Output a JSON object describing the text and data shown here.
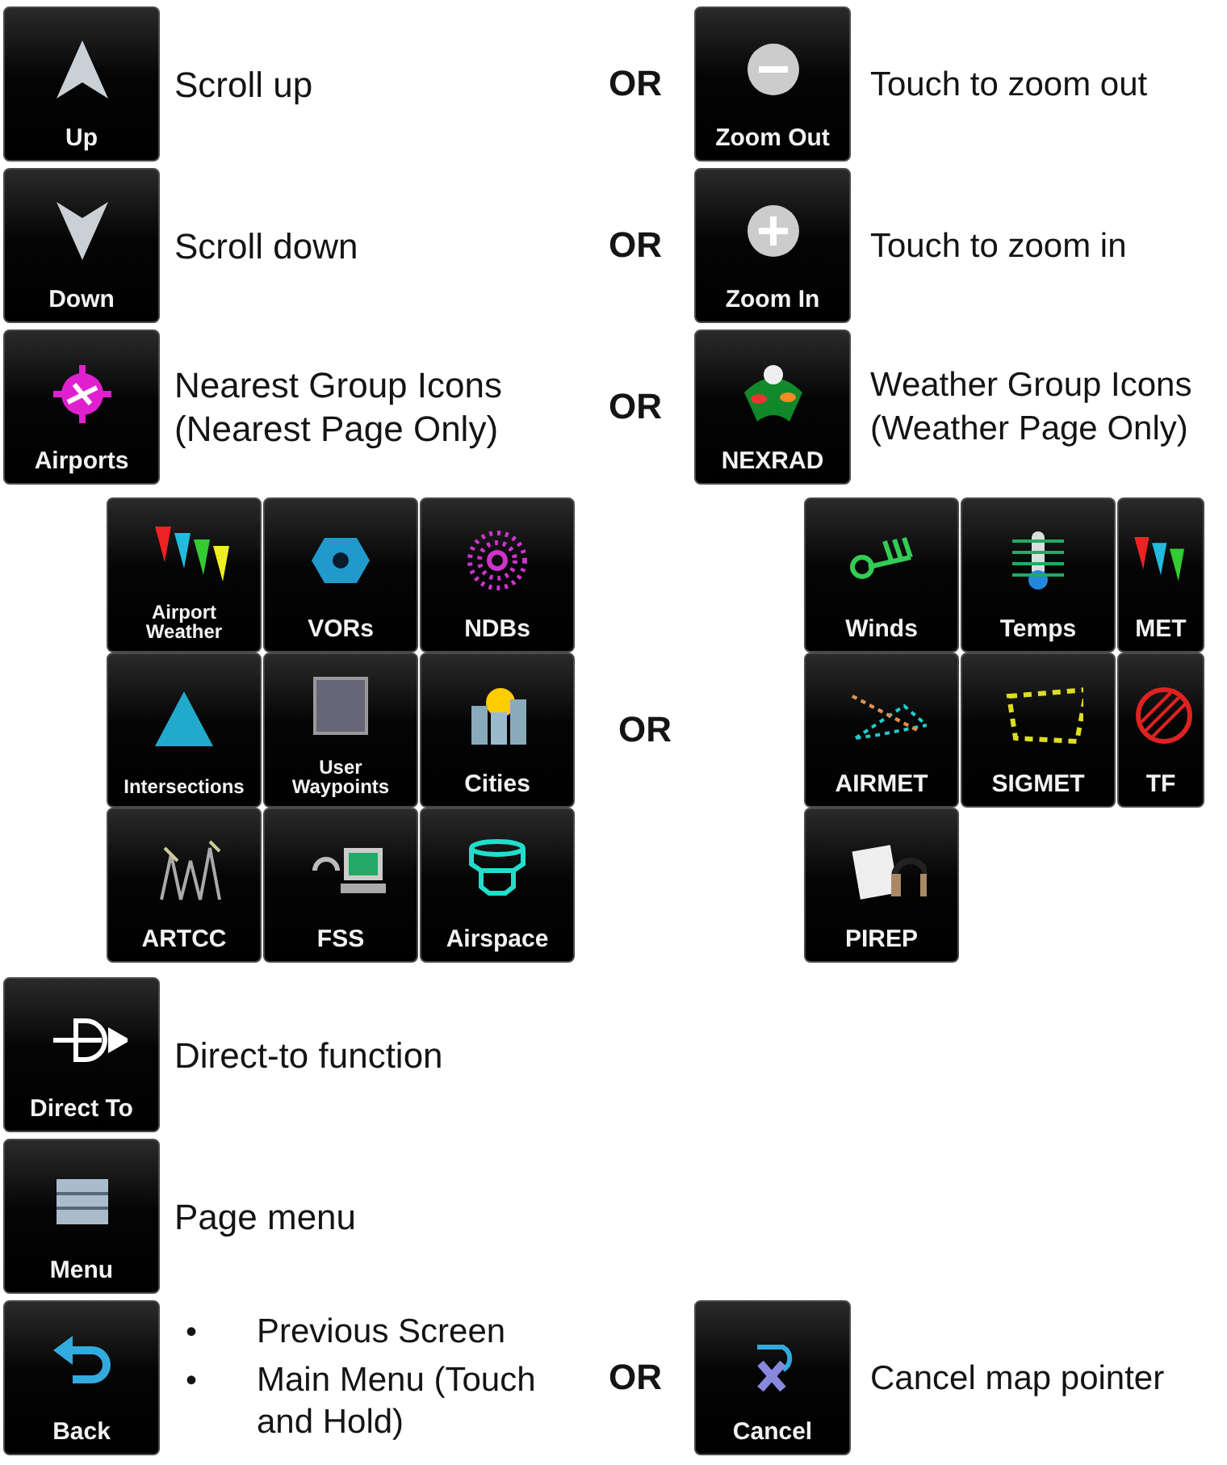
{
  "rows": [
    {
      "button": "Up",
      "description": [
        "Scroll up"
      ],
      "or": "OR",
      "alt": {
        "button": "Zoom Out",
        "description": [
          "Touch to zoom out"
        ]
      }
    },
    {
      "button": "Down",
      "description": [
        "Scroll down"
      ],
      "or": "OR",
      "alt": {
        "button": "Zoom In",
        "description": [
          "Touch to zoom in"
        ]
      }
    },
    {
      "button": "Airports",
      "description": [
        "Nearest Group Icons",
        "(Nearest Page Only)"
      ],
      "or": "OR",
      "alt": {
        "button": "NEXRAD",
        "description": [
          "Weather Group Icons",
          "(Weather Page Only)"
        ]
      }
    }
  ],
  "nearest_grid": [
    "Airport Weather",
    "VORs",
    "NDBs",
    "Intersections",
    "User Waypoints",
    "Cities",
    "ARTCC",
    "FSS",
    "Airspace"
  ],
  "grid_or": "OR",
  "weather_grid": [
    "Winds",
    "Temps",
    "MET",
    "AIRMET",
    "SIGMET",
    "TF",
    "PIREP"
  ],
  "lower_rows": [
    {
      "button": "Direct To",
      "description": [
        "Direct-to function"
      ]
    },
    {
      "button": "Menu",
      "description": [
        "Page menu"
      ]
    }
  ],
  "back_row": {
    "button": "Back",
    "bullets": [
      {
        "marker": "•",
        "text": "Previous Screen"
      },
      {
        "marker": "•",
        "text": "Main Menu (Touch and Hold)"
      }
    ],
    "or": "OR",
    "alt": {
      "button": "Cancel",
      "description": [
        "Cancel map pointer"
      ]
    }
  }
}
